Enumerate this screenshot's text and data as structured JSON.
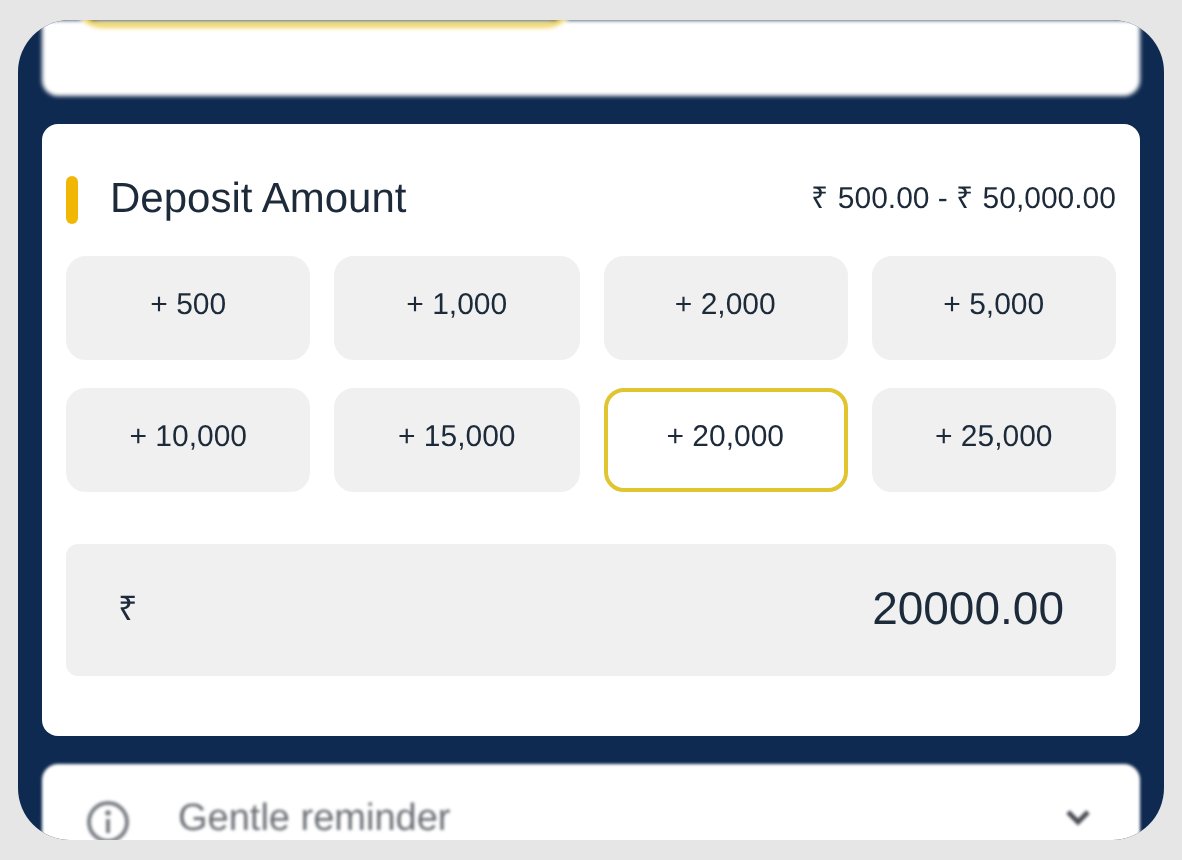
{
  "deposit": {
    "title": "Deposit Amount",
    "range": "₹ 500.00 - ₹ 50,000.00",
    "options": [
      {
        "label": "+ 500",
        "selected": false
      },
      {
        "label": "+ 1,000",
        "selected": false
      },
      {
        "label": "+ 2,000",
        "selected": false
      },
      {
        "label": "+ 5,000",
        "selected": false
      },
      {
        "label": "+ 10,000",
        "selected": false
      },
      {
        "label": "+ 15,000",
        "selected": false
      },
      {
        "label": "+ 20,000",
        "selected": true
      },
      {
        "label": "+ 25,000",
        "selected": false
      }
    ],
    "amount": {
      "currency": "₹",
      "value": "20000.00"
    }
  },
  "reminder": {
    "title": "Gentle reminder",
    "expanded": false
  }
}
